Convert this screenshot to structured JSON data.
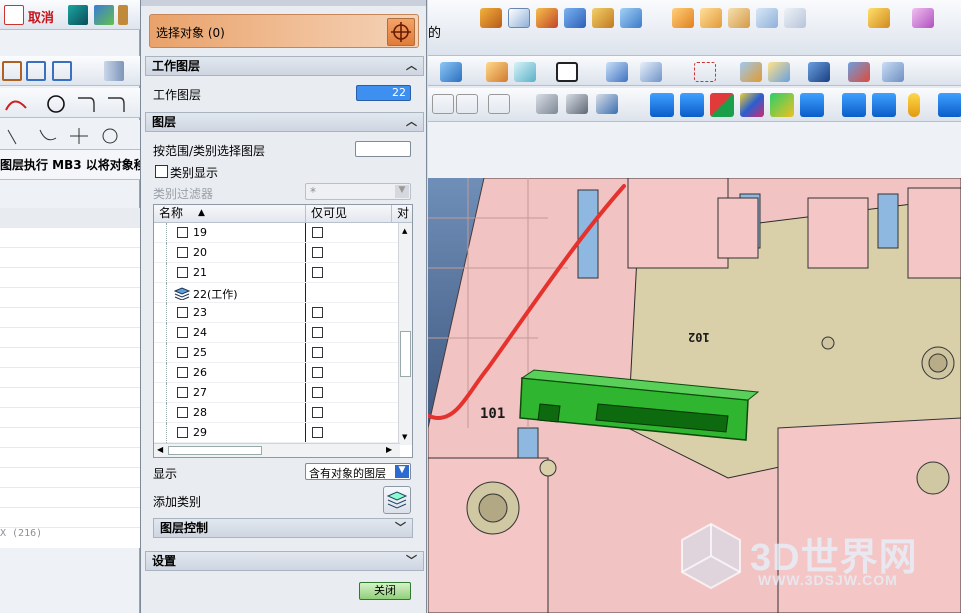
{
  "app": {
    "cancel_label": "取消",
    "right_text_fragment": "的",
    "command_bar": "图层执行  MB3  以将对象移",
    "status_text": "X (216)"
  },
  "dialog": {
    "select_section": {
      "label": "选择对象 (0)"
    },
    "work_layer_section": {
      "title": "工作图层",
      "field_label": "工作图层",
      "value": "22"
    },
    "layers_section": {
      "title": "图层",
      "range_label": "按范围/类别选择图层",
      "range_value": "",
      "category_display_label": "类别显示",
      "category_filter_label": "类别过滤器",
      "category_filter_value": "*",
      "table": {
        "columns": [
          "名称",
          "仅可见",
          "对"
        ],
        "rows": [
          {
            "name": "19",
            "work": false
          },
          {
            "name": "20",
            "work": false
          },
          {
            "name": "21",
            "work": false
          },
          {
            "name": "22(工作)",
            "work": true
          },
          {
            "name": "23",
            "work": false
          },
          {
            "name": "24",
            "work": false
          },
          {
            "name": "25",
            "work": false
          },
          {
            "name": "26",
            "work": false
          },
          {
            "name": "27",
            "work": false
          },
          {
            "name": "28",
            "work": false
          },
          {
            "name": "29",
            "work": false
          }
        ]
      },
      "display_label": "显示",
      "display_value": "含有对象的图层",
      "add_category_label": "添加类别",
      "layer_control_label": "图层控制"
    },
    "settings_label": "设置",
    "close_label": "关闭"
  },
  "viewport": {
    "label_101": "101",
    "label_102": "102",
    "watermark_main": "3D世界网",
    "watermark_url": "WWW.3DSJW.COM"
  },
  "colors": {
    "accent_orange": "#e48b4c",
    "work_field_blue": "#3d8ff0",
    "pink_part": "#f4c6c6",
    "tan_part": "#dcd2ad",
    "green_part": "#2fb52f",
    "red_annotation": "#e5322d"
  }
}
